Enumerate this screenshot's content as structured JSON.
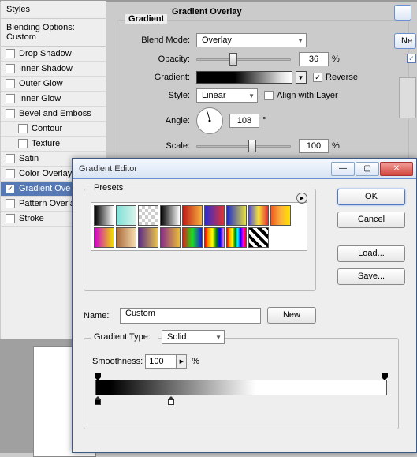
{
  "layerstyle": {
    "panel_title": "Styles",
    "blending_options": "Blending Options: Custom",
    "items": [
      {
        "label": "Drop Shadow",
        "checked": false
      },
      {
        "label": "Inner Shadow",
        "checked": false
      },
      {
        "label": "Outer Glow",
        "checked": false
      },
      {
        "label": "Inner Glow",
        "checked": false
      },
      {
        "label": "Bevel and Emboss",
        "checked": false
      },
      {
        "label": "Contour",
        "checked": false,
        "indent": true
      },
      {
        "label": "Texture",
        "checked": false,
        "indent": true
      },
      {
        "label": "Satin",
        "checked": false
      },
      {
        "label": "Color Overlay",
        "checked": false
      },
      {
        "label": "Gradient Overlay",
        "checked": true,
        "selected": true,
        "display": "Gradient Ove"
      },
      {
        "label": "Pattern Overlay",
        "checked": false
      },
      {
        "label": "Stroke",
        "checked": false
      }
    ],
    "section_title": "Gradient Overlay",
    "group_title": "Gradient",
    "blend_mode_label": "Blend Mode:",
    "blend_mode_value": "Overlay",
    "opacity_label": "Opacity:",
    "opacity_value": "36",
    "gradient_label": "Gradient:",
    "reverse_label": "Reverse",
    "reverse_checked": true,
    "style_label": "Style:",
    "style_value": "Linear",
    "align_label": "Align with Layer",
    "align_checked": false,
    "angle_label": "Angle:",
    "angle_value": "108",
    "scale_label": "Scale:",
    "scale_value": "100",
    "pct": "%",
    "deg": "°",
    "rt_button_partial": "Ne",
    "rt_check_visible": true
  },
  "ge": {
    "title": "Gradient Editor",
    "presets_label": "Presets",
    "ok": "OK",
    "cancel": "Cancel",
    "load": "Load...",
    "save": "Save...",
    "name_label": "Name:",
    "name_value": "Custom",
    "new": "New",
    "gtype_label": "Gradient Type:",
    "gtype_value": "Solid",
    "smooth_label": "Smoothness:",
    "smooth_value": "100",
    "pct": "%",
    "swatches": [
      "linear-gradient(to right,#000,#fff)",
      "linear-gradient(to right,#7fe1d8,#d6f2ea)",
      "repeating-conic-gradient(#ccc 0 25%, #fff 0 50%) 50% / 8px 8px",
      "linear-gradient(to right,#000,#fff)",
      "linear-gradient(to right,#c01818,#f6b13d)",
      "linear-gradient(to right,#2b2bd1,#e23434)",
      "linear-gradient(to right,#1f2bd0,#e7e13b)",
      "linear-gradient(to right,#5050e0,#f7e23a,#e33131)",
      "linear-gradient(to right,#f15a24,#fbb03b,#ffe400)",
      "linear-gradient(to right,#d000d0,#f0e000)",
      "linear-gradient(to right,#aa6a3a,#f5dab0)",
      "linear-gradient(to right,#5a2a86,#e9c54e)",
      "linear-gradient(to right,#872a8a,#e7bc3a)",
      "linear-gradient(to right,#e21a1a,#1ae21a,#1a1ae2)",
      "linear-gradient(to right,red,orange,yellow,green,blue,violet)",
      "linear-gradient(to right,red,orange,yellow,green,cyan,blue,magenta,red)",
      "repeating-linear-gradient(45deg,#000 0 4px,#fff 4px 8px)"
    ]
  }
}
